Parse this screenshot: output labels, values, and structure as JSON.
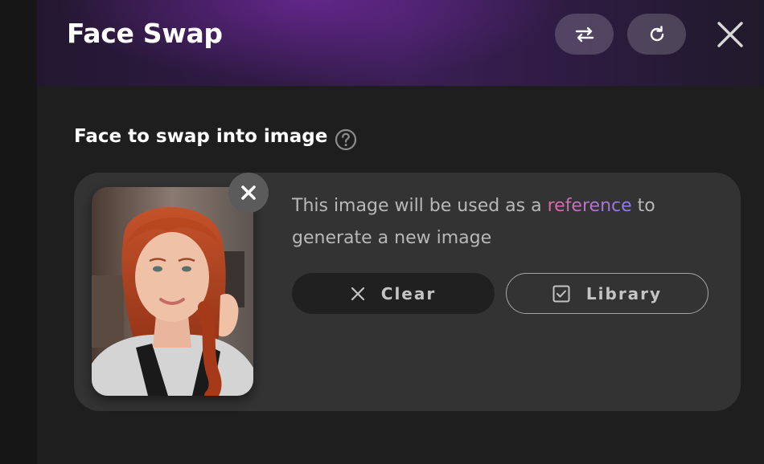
{
  "header": {
    "title": "Face Swap",
    "swap_icon": "swap-arrows-icon",
    "refresh_icon": "refresh-icon",
    "close_icon": "close-icon"
  },
  "section": {
    "title": "Face to swap into image",
    "help_icon": "question-circle-icon"
  },
  "reference_card": {
    "description_before": "This image will be used as a ",
    "description_highlight": "reference",
    "description_after": " to generate a new image",
    "clear_label": "Clear",
    "library_label": "Library",
    "image_alt": "reference face photo",
    "remove_icon": "close-icon"
  },
  "colors": {
    "accent_gradient_start": "#e06aa2",
    "accent_gradient_end": "#8a7cf0",
    "header_purple": "#3b1f57",
    "card_bg": "#333333"
  }
}
